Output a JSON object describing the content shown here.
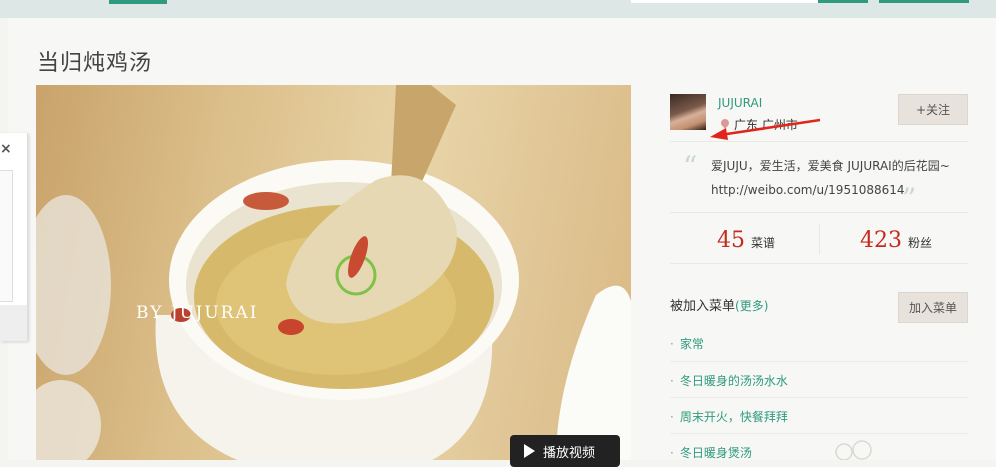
{
  "page": {
    "title": "当归炖鸡汤"
  },
  "photo": {
    "watermark": "BY   JUJURAI",
    "play_label": "播放视频"
  },
  "popup": {
    "close_symbol": "×"
  },
  "author": {
    "name": "JUJURAI",
    "location": "广东 广州市",
    "follow_label": "+关注",
    "bio_line1": "爱JUJU，爱生活，爱美食 JUJURAI的后花园~",
    "bio_line2": "http://weibo.com/u/1951088614",
    "quote_open": "“",
    "quote_close": "”"
  },
  "stats": {
    "recipes_count": "45",
    "recipes_label": "菜谱",
    "fans_count": "423",
    "fans_label": "粉丝"
  },
  "added": {
    "title": "被加入菜单",
    "more_label": "(更多)",
    "add_label": "加入菜单",
    "bullet": "·",
    "items": [
      {
        "label": "家常"
      },
      {
        "label": "冬日暖身的汤汤水水"
      },
      {
        "label": "周末开火，快餐拜拜"
      },
      {
        "label": "冬日暖身煲汤"
      }
    ]
  },
  "colors": {
    "accent": "#2f9a7e",
    "stat_red": "#c52a1e",
    "button_bg": "#e8e2dc"
  }
}
